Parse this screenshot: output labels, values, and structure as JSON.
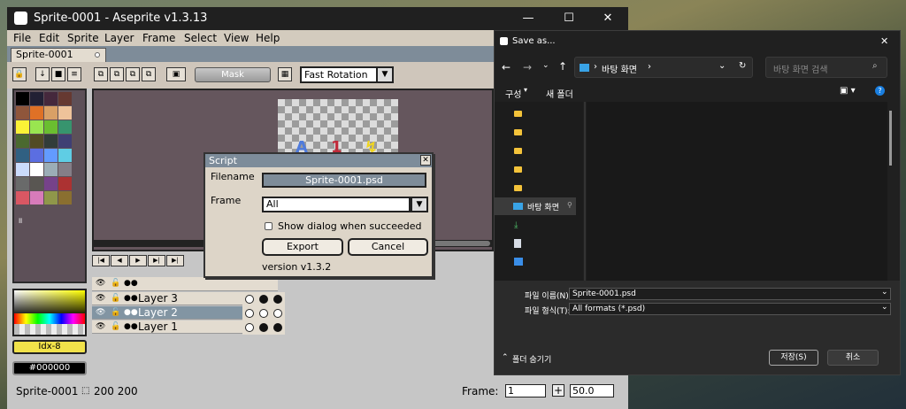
{
  "aseprite": {
    "title": "Sprite-0001 - Aseprite v1.3.13",
    "menu": [
      "File",
      "Edit",
      "Sprite",
      "Layer",
      "Frame",
      "Select",
      "View",
      "Help"
    ],
    "tab": "Sprite-0001",
    "toolbar": {
      "mask_label": "Mask",
      "rotation": "Fast Rotation"
    },
    "palette_colors": [
      "#000000",
      "#222034",
      "#45283c",
      "#663931",
      "#8f563b",
      "#df7126",
      "#d9a066",
      "#eec39a",
      "#fbf236",
      "#99e550",
      "#6abe30",
      "#37946e",
      "#4b692f",
      "#524b24",
      "#323c39",
      "#3f3f74",
      "#306082",
      "#5b6ee1",
      "#639bff",
      "#5fcde4",
      "#cbdbfc",
      "#ffffff",
      "#9badb7",
      "#847e87",
      "#696a6a",
      "#595652",
      "#76428a",
      "#ac3232",
      "#d95763",
      "#d77bba",
      "#8f974a",
      "#8a6f30"
    ],
    "idx_label": "Idx-8",
    "hex_label": "#000000",
    "layers": [
      "Layer 3",
      "Layer 2",
      "Layer 1"
    ],
    "status": {
      "sprite": "Sprite-0001",
      "size": "200 200",
      "frame_label": "Frame:",
      "frame_value": "1",
      "zoom": "50.0"
    }
  },
  "script_dialog": {
    "title": "Script",
    "filename_label": "Filename",
    "filename_value": "Sprite-0001.psd",
    "frame_label": "Frame",
    "frame_value": "All",
    "checkbox_label": "Show dialog when succeeded",
    "export_label": "Export",
    "cancel_label": "Cancel",
    "version": "version v1.3.2"
  },
  "save_dialog": {
    "title": "Save as...",
    "address": "바탕 화면",
    "search_placeholder": "바탕 화면 검색",
    "organize_label": "구성",
    "new_folder_label": "새 폴더",
    "nav_desktop": "바탕 화면",
    "filename_label": "파일 이름(N):",
    "filename_value": "Sprite-0001.psd",
    "filetype_label": "파일 형식(T):",
    "filetype_value": "All formats (*.psd)",
    "hide_folders_label": "폴더 숨기기",
    "save_label": "저장(S)",
    "cancel_label": "취소"
  }
}
